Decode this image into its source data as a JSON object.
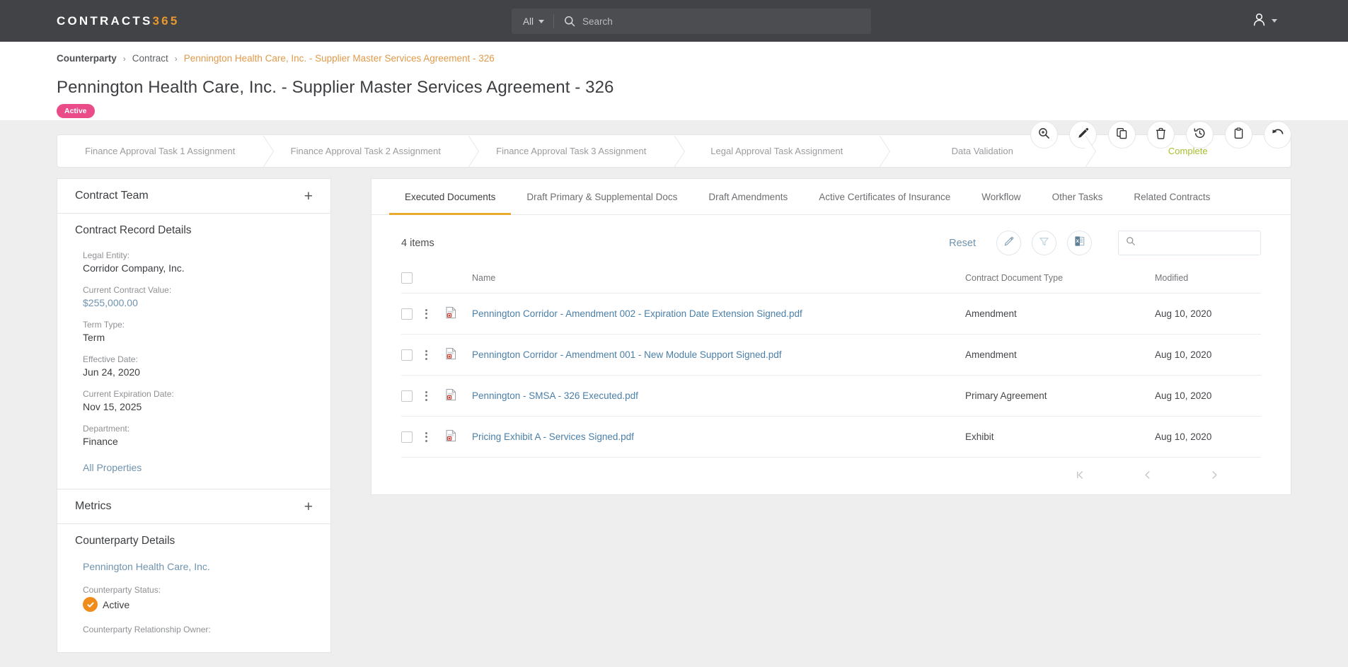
{
  "topbar": {
    "brand_main": "CONTRACTS",
    "brand_num": "365",
    "search_scope": "All",
    "search_placeholder": "Search",
    "search_value": "",
    "search_icon": "search-icon",
    "user_icon": "user-avatar-icon",
    "bg_color": "#414346",
    "accent_color": "#e8982f"
  },
  "breadcrumb": {
    "items": [
      {
        "label": "Counterparty",
        "current": false
      },
      {
        "label": "Contract",
        "current": false
      },
      {
        "label": "Pennington Health Care, Inc. - Supplier Master Services Agreement - 326",
        "current": true
      }
    ],
    "separator": "›",
    "current_color": "#e09a4a"
  },
  "page": {
    "title": "Pennington Health Care, Inc. - Supplier Master Services Agreement - 326",
    "status_badge": "Active",
    "status_badge_color": "#ea4c89"
  },
  "header_actions": [
    {
      "name": "zoom-in-icon",
      "title": "Preview"
    },
    {
      "name": "pencil-icon",
      "title": "Edit"
    },
    {
      "name": "copy-icon",
      "title": "Copy"
    },
    {
      "name": "trash-icon",
      "title": "Delete"
    },
    {
      "name": "history-icon",
      "title": "History"
    },
    {
      "name": "clipboard-icon",
      "title": "Clipboard"
    },
    {
      "name": "undo-icon",
      "title": "Undo"
    }
  ],
  "stepper": {
    "steps": [
      {
        "label": "Finance Approval Task 1 Assignment",
        "state": "pending"
      },
      {
        "label": "Finance Approval Task 2 Assignment",
        "state": "pending"
      },
      {
        "label": "Finance Approval Task 3 Assignment",
        "state": "pending"
      },
      {
        "label": "Legal Approval Task Assignment",
        "state": "pending"
      },
      {
        "label": "Data Validation",
        "state": "pending"
      },
      {
        "label": "Complete",
        "state": "done"
      }
    ],
    "done_color": "#a9bd2e"
  },
  "sidebar": {
    "contract_team": {
      "title": "Contract Team",
      "add_label": "+"
    },
    "record_details": {
      "title": "Contract Record Details",
      "fields": [
        {
          "label": "Legal Entity:",
          "value": "Corridor Company, Inc.",
          "link": false
        },
        {
          "label": "Current Contract Value:",
          "value": "$255,000.00",
          "link": true
        },
        {
          "label": "Term Type:",
          "value": "Term",
          "link": false
        },
        {
          "label": "Effective Date:",
          "value": "Jun 24, 2020",
          "link": false
        },
        {
          "label": "Current Expiration Date:",
          "value": "Nov 15, 2025",
          "link": false
        },
        {
          "label": "Department:",
          "value": "Finance",
          "link": false
        }
      ],
      "all_properties": "All Properties"
    },
    "metrics": {
      "title": "Metrics",
      "add_label": "+"
    },
    "counterparty": {
      "title": "Counterparty Details",
      "name": "Pennington Health Care, Inc.",
      "status_label": "Counterparty Status:",
      "status_value": "Active",
      "status_icon": "check-circle-icon",
      "status_color": "#f08c1b",
      "owner_label": "Counterparty Relationship Owner:"
    }
  },
  "main": {
    "tabs": [
      {
        "label": "Executed Documents",
        "active": true
      },
      {
        "label": "Draft Primary & Supplemental Docs",
        "active": false
      },
      {
        "label": "Draft Amendments",
        "active": false
      },
      {
        "label": "Active Certificates of Insurance",
        "active": false
      },
      {
        "label": "Workflow",
        "active": false
      },
      {
        "label": "Other Tasks",
        "active": false
      },
      {
        "label": "Related Contracts",
        "active": false
      }
    ],
    "toolbar": {
      "items_count": "4 items",
      "reset_label": "Reset",
      "buttons": [
        {
          "name": "pencil-icon"
        },
        {
          "name": "filter-funnel-icon"
        },
        {
          "name": "excel-export-icon"
        }
      ],
      "search_placeholder": "",
      "search_value": "",
      "search_icon": "search-icon"
    },
    "table": {
      "columns": [
        "",
        "",
        "",
        "Name",
        "Contract Document Type",
        "Modified"
      ],
      "headers": {
        "name": "Name",
        "type": "Contract Document Type",
        "modified": "Modified"
      },
      "rows": [
        {
          "selected": false,
          "file_icon": "pdf-file-icon",
          "name": "Pennington Corridor - Amendment 002 - Expiration Date Extension Signed.pdf",
          "type": "Amendment",
          "modified": "Aug 10, 2020"
        },
        {
          "selected": false,
          "file_icon": "pdf-file-icon",
          "name": "Pennington Corridor - Amendment 001 - New Module Support Signed.pdf",
          "type": "Amendment",
          "modified": "Aug 10, 2020"
        },
        {
          "selected": false,
          "file_icon": "pdf-file-icon",
          "name": "Pennington - SMSA - 326 Executed.pdf",
          "type": "Primary Agreement",
          "modified": "Aug 10, 2020"
        },
        {
          "selected": false,
          "file_icon": "pdf-file-icon",
          "name": "Pricing Exhibit A - Services Signed.pdf",
          "type": "Exhibit",
          "modified": "Aug 10, 2020"
        }
      ]
    },
    "pagination": {
      "first": "first-page-icon",
      "prev": "previous-page-icon",
      "next": "next-page-icon"
    }
  }
}
